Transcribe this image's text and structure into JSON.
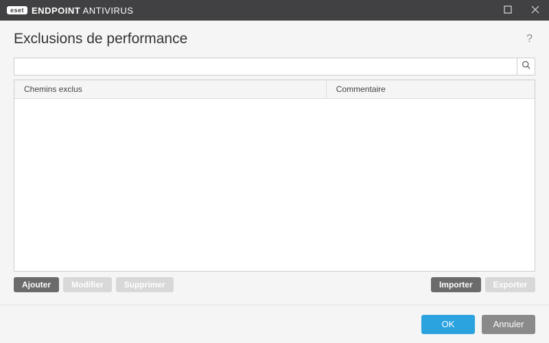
{
  "titlebar": {
    "brand_badge": "eset",
    "brand_text_1": "ENDPOINT",
    "brand_text_2": "ANTIVIRUS"
  },
  "header": {
    "title": "Exclusions de performance"
  },
  "search": {
    "value": "",
    "placeholder": ""
  },
  "table": {
    "columns": {
      "path": "Chemins exclus",
      "comment": "Commentaire"
    },
    "rows": []
  },
  "toolbar": {
    "add": "Ajouter",
    "edit": "Modifier",
    "delete": "Supprimer",
    "import": "Importer",
    "export": "Exporter"
  },
  "footer": {
    "ok": "OK",
    "cancel": "Annuler"
  }
}
